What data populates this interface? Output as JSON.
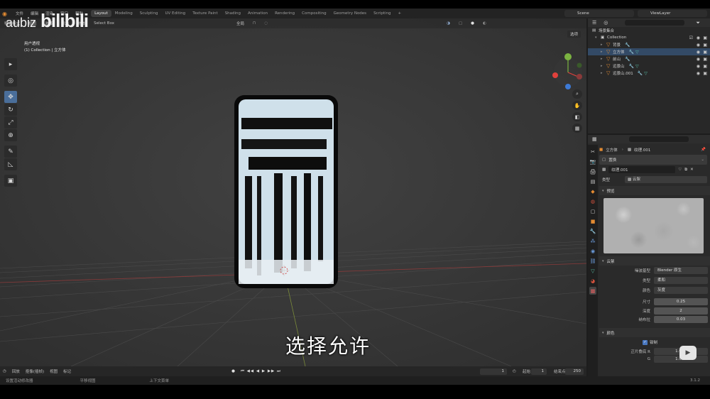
{
  "watermark": {
    "text": "aubiz",
    "logo": "bilibili"
  },
  "topbar": {
    "menu": [
      "文件",
      "编辑",
      "渲染",
      "窗口",
      "帮助"
    ],
    "workspaces": [
      "Layout",
      "Modeling",
      "Sculpting",
      "UV Editing",
      "Texture Paint",
      "Shading",
      "Animation",
      "Rendering",
      "Compositing",
      "Geometry Nodes",
      "Scripting",
      "+"
    ],
    "active_workspace": "Layout",
    "scene": "Scene",
    "view_layer": "ViewLayer"
  },
  "viewport": {
    "header_items": [
      "物体模式",
      "视图",
      "选择",
      "添加",
      "物体",
      "Select Box",
      "全局"
    ],
    "info_line1": "用户透视",
    "info_line2": "(1) Collection | 立方体",
    "options_label": "选项",
    "subtitle": "选择允许"
  },
  "toolbar": {
    "tools": [
      {
        "icon": "cursor-select-icon",
        "glyph": "▸",
        "active": false
      },
      {
        "icon": "cursor-icon",
        "glyph": "◎",
        "active": false
      },
      {
        "icon": "move-icon",
        "glyph": "✥",
        "active": true
      },
      {
        "icon": "rotate-icon",
        "glyph": "↻",
        "active": false
      },
      {
        "icon": "scale-icon",
        "glyph": "⤢",
        "active": false
      },
      {
        "icon": "transform-icon",
        "glyph": "⊕",
        "active": false
      },
      {
        "icon": "annotate-icon",
        "glyph": "✎",
        "active": false
      },
      {
        "icon": "measure-icon",
        "glyph": "📐",
        "active": false
      },
      {
        "icon": "add-cube-icon",
        "glyph": "▣",
        "active": false
      }
    ]
  },
  "timeline": {
    "items": [
      "回放",
      "抠像(插帧)",
      "视图",
      "标记"
    ],
    "current_frame": "1",
    "start_label": "起始",
    "start_value": "1",
    "end_label": "结束点",
    "end_value": "250"
  },
  "statusbar": {
    "items": [
      "设置活动修改器",
      "平移视图",
      "上下文菜单"
    ],
    "version": "3.1.2"
  },
  "outliner": {
    "root": "场景集合",
    "collection": "Collection",
    "objects": [
      "背景",
      "立方体",
      "前山",
      "远景山",
      "远景山.001"
    ],
    "selected": "立方体"
  },
  "properties": {
    "object_name": "立方体",
    "texture_name": "纹理.001",
    "slot_label": "置换",
    "texture_field": "纹理.001",
    "type_label": "类型",
    "type_value": "云絮",
    "preview_label": "预览",
    "clouds_label": "云絮",
    "noise_basis_label": "噪波基型",
    "noise_basis_value": "Blender 原生",
    "cloud_type_label": "类型",
    "cloud_type_value": "柔和",
    "color_label": "颜色",
    "color_value": "灰度",
    "size_label": "尺寸",
    "size_value": "0.25",
    "depth_label": "深度",
    "depth_value": "2",
    "nabla_label": "纳布拉",
    "nabla_value": "0.03",
    "colors_section": "颜色",
    "clamp_label": "钳制",
    "brightness_label": "正片叠底 R",
    "r_value": "1.000",
    "g_label": "G",
    "g_value": "1.000"
  },
  "colors": {
    "accent": "#4a6e9a",
    "object_orange": "#e38b32",
    "axis_red": "#e1413c",
    "axis_green": "#7bb341",
    "axis_blue": "#3d7ad6"
  }
}
